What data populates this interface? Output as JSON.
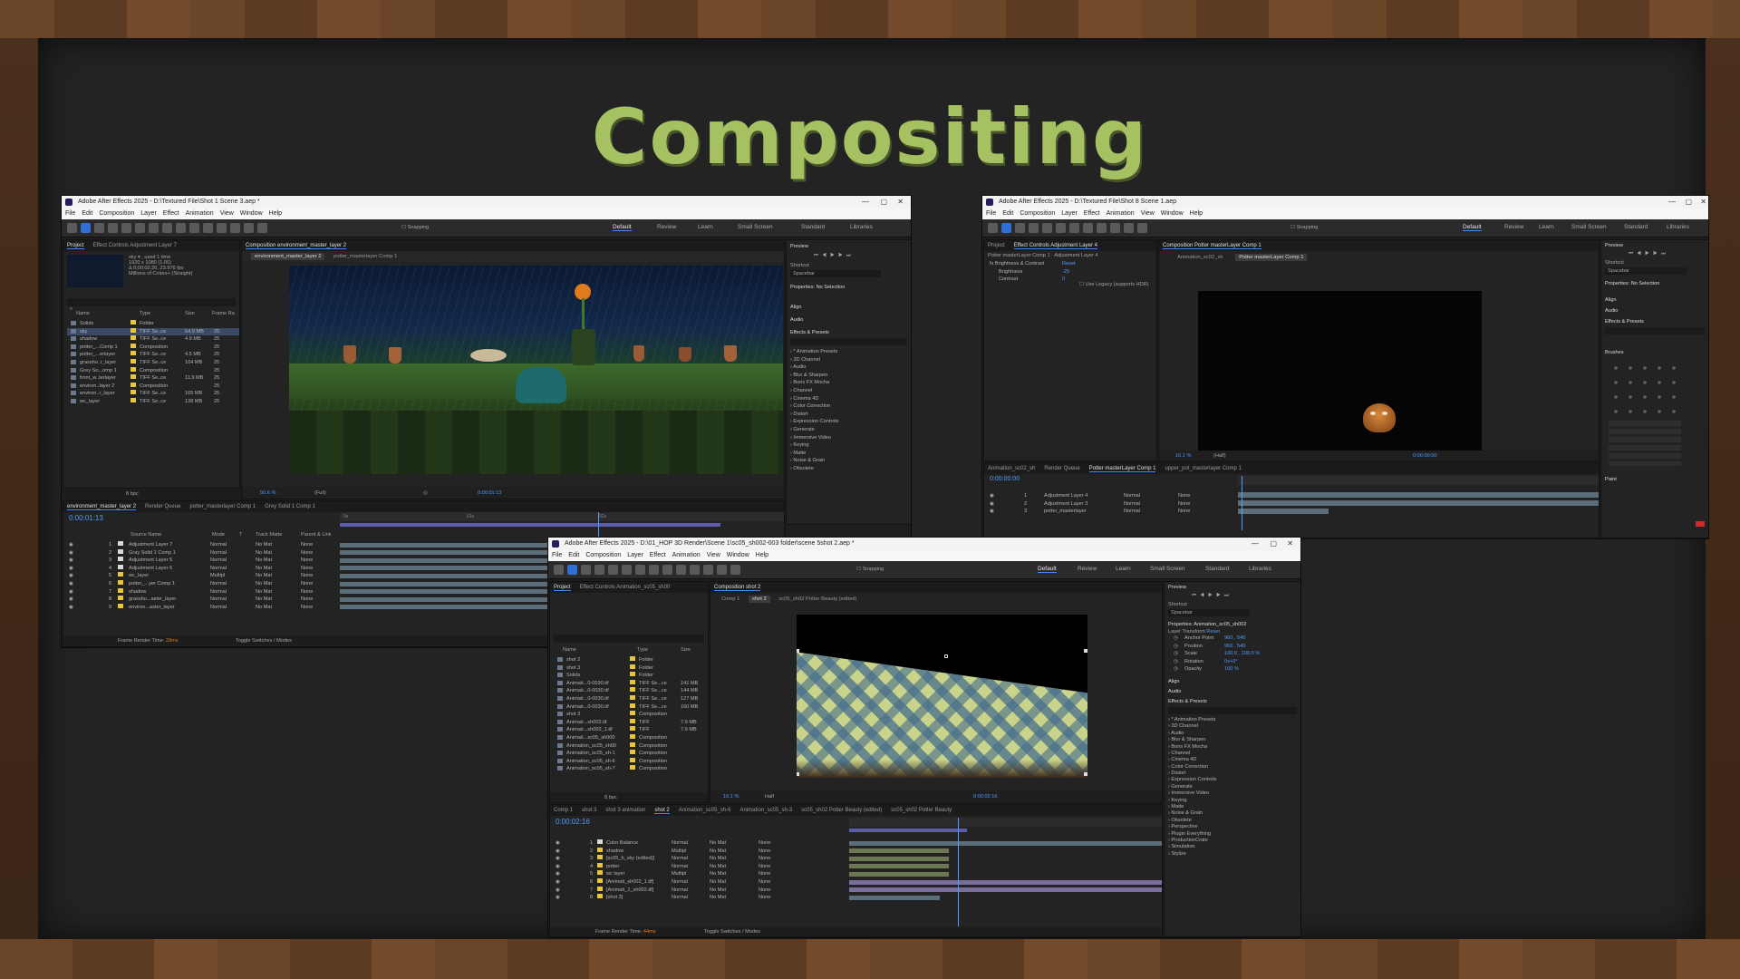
{
  "title": "Compositing",
  "win1": {
    "title": "Adobe After Effects 2025 - D:\\Textured File\\Shot 1 Scene 3.aep *",
    "menu": [
      "File",
      "Edit",
      "Composition",
      "Layer",
      "Effect",
      "Animation",
      "View",
      "Window",
      "Help"
    ],
    "snapping": "Snapping",
    "workspaces": [
      "Default",
      "Review",
      "Learn",
      "Small Screen",
      "Standard",
      "Libraries"
    ],
    "project_tab": "Project",
    "effect_controls_tab": "Effect Controls Adjustment Layer 7",
    "project_info": [
      "sky ▾ , used 1 time",
      "1920 x 1080 (1.00)",
      "Δ 0;00;02;26, 23.976 fps",
      "Millions of Colors+ (Straight)"
    ],
    "project_columns": [
      "Name",
      "Type",
      "Size",
      "Frame Ra"
    ],
    "project_items": [
      {
        "name": "Solids",
        "type": "Folder",
        "size": "",
        "fr": "",
        "color": "#e8c53a"
      },
      {
        "name": "sky",
        "type": "TIFF Se..ce",
        "size": "64.9 MB",
        "fr": "25",
        "color": "#e8c53a"
      },
      {
        "name": "shadow",
        "type": "TIFF Se..ce",
        "size": "4.9 MB",
        "fr": "25",
        "color": "#e8c53a"
      },
      {
        "name": "potter_...Comp 1",
        "type": "Composition",
        "size": "",
        "fr": "25",
        "color": "#e8c53a"
      },
      {
        "name": "potter_...erlayer",
        "type": "TIFF Se..ce",
        "size": "4.5 MB",
        "fr": "25",
        "color": "#e8c53a"
      },
      {
        "name": "grassho..r_layer",
        "type": "TIFF Se..ce",
        "size": "104 MB",
        "fr": "25",
        "color": "#e8c53a"
      },
      {
        "name": "Grey So...omp 1",
        "type": "Composition",
        "size": "",
        "fr": "25",
        "color": "#e8c53a"
      },
      {
        "name": "front_w..terlayer",
        "type": "TIFF Se..ce",
        "size": "11.9 MB",
        "fr": "25",
        "color": "#e8c53a"
      },
      {
        "name": "environ..layer 2",
        "type": "Composition",
        "size": "",
        "fr": "25",
        "color": "#e8c53a"
      },
      {
        "name": "environ..r_layer",
        "type": "TIFF Se..ce",
        "size": "165 MB",
        "fr": "25",
        "color": "#e8c53a"
      },
      {
        "name": "wc_layer",
        "type": "TIFF Se..ce",
        "size": "138 MB",
        "fr": "25",
        "color": "#e8c53a"
      }
    ],
    "bpc": "8 bpc",
    "comp_tab": "Composition environment_master_layer 2",
    "comp_subtabs": [
      "environment_master_layer 2",
      "potter_masterlayer Comp 1"
    ],
    "zoom": "50.6 %",
    "resolution": "(Full)",
    "timecode_viewer": "0:00:01:13",
    "preview_label": "Preview",
    "shortcut_label": "Shortcut",
    "shortcut_value": "Spacebar",
    "properties_label": "Properties: No Selection",
    "align_label": "Align",
    "audio_label": "Audio",
    "effects_label": "Effects & Presets",
    "effects_items": [
      "* Animation Presets",
      "3D Channel",
      "Audio",
      "Blur & Sharpen",
      "Boris FX Mocha",
      "Channel",
      "Cinema 4D",
      "Color Correction",
      "Distort",
      "Expression Controls",
      "Generate",
      "Immersive Video",
      "Keying",
      "Matte",
      "Noise & Grain",
      "Obsolete"
    ],
    "timeline_tabs": [
      "environment_master_layer 2",
      "Render Queue",
      "potter_masterlayer Comp 1",
      "Grey Solid 1 Comp 1"
    ],
    "timecode": "0:00:01:13",
    "layer_columns": [
      "Source Name",
      "Mode",
      "T",
      "Track Matte",
      "Parent & Link"
    ],
    "layers": [
      {
        "num": "1",
        "name": "Adjustment Layer 7",
        "mode": "Normal",
        "matte": "No Mat",
        "parent": "None",
        "color": "#d9d9d9"
      },
      {
        "num": "2",
        "name": "Gray Solid 1 Comp 1",
        "mode": "Normal",
        "matte": "No Mat",
        "parent": "None",
        "color": "#d9d9d9"
      },
      {
        "num": "3",
        "name": "Adjustment Layer 5",
        "mode": "Normal",
        "matte": "No Mat",
        "parent": "None",
        "color": "#d9d9d9"
      },
      {
        "num": "4",
        "name": "Adjustment Layer 6",
        "mode": "Normal",
        "matte": "No Mat",
        "parent": "None",
        "color": "#d9d9d9"
      },
      {
        "num": "5",
        "name": "wc_layer",
        "mode": "Multipl",
        "matte": "No Mat",
        "parent": "None",
        "color": "#e8c53a"
      },
      {
        "num": "6",
        "name": "potter_...yer Comp 1",
        "mode": "Normal",
        "matte": "No Mat",
        "parent": "None",
        "color": "#e8c53a"
      },
      {
        "num": "7",
        "name": "shadow",
        "mode": "Normal",
        "matte": "No Mat",
        "parent": "None",
        "color": "#e8c53a"
      },
      {
        "num": "8",
        "name": "grassho...aster_layer",
        "mode": "Normal",
        "matte": "No Mat",
        "parent": "None",
        "color": "#e8c53a"
      },
      {
        "num": "9",
        "name": "environ...aster_layer",
        "mode": "Normal",
        "matte": "No Mat",
        "parent": "None",
        "color": "#e8c53a"
      }
    ],
    "ruler_marks": [
      "0s",
      "01s",
      "02s"
    ],
    "frame_render": "Frame Render Time:",
    "frame_render_value": "29ms",
    "toggle_label": "Toggle Switches / Modes"
  },
  "win2": {
    "title": "Adobe After Effects 2025 - D:\\Textured File\\Shot 8 Scene 1.aep",
    "menu": [
      "File",
      "Edit",
      "Composition",
      "Layer",
      "Effect",
      "Animation",
      "View",
      "Window",
      "Help"
    ],
    "snapping": "Snapping",
    "workspaces": [
      "Default",
      "Review",
      "Learn",
      "Small Screen",
      "Standard",
      "Libraries"
    ],
    "project_tab": "Project",
    "effect_controls_tab": "Effect Controls Adjustment Layer 4",
    "ec_header": "Potter masterLayer Comp 1 · Adjustment Layer 4",
    "ec_items": [
      {
        "label": "fx  Brightness & Contrast",
        "value": "Reset"
      },
      {
        "label": "Brightness",
        "value": "-25"
      },
      {
        "label": "Contrast",
        "value": "0"
      }
    ],
    "legacy": "Use Legacy (supports HDR)",
    "comp_tab": "Composition Potter masterLayer Comp 1",
    "comp_subtabs": [
      "Animation_sc02_sh",
      "Potter masterLayer Comp 1"
    ],
    "zoom": "16.1 %",
    "resolution": "(Half)",
    "timecode_viewer": "0:00:00:00",
    "preview_label": "Preview",
    "shortcut_label": "Shortcut",
    "shortcut_value": "Spacebar",
    "properties_label": "Properties: No Selection",
    "align_label": "Align",
    "audio_label": "Audio",
    "effects_label": "Effects & Presets",
    "brushes_label": "Brushes",
    "paint_label": "Paint",
    "timeline_tabs": [
      "Animation_sc02_sh",
      "Render Queue",
      "Potter masterLayer Comp 1",
      "upper_pot_masterlayer Comp 1"
    ],
    "timecode": "0:00:00:00",
    "layers": [
      {
        "num": "1",
        "name": "Adjustment Layer 4",
        "mode": "Normal",
        "parent": "None"
      },
      {
        "num": "2",
        "name": "Adjustment Layer 3",
        "mode": "Normal",
        "parent": "None"
      },
      {
        "num": "3",
        "name": "potter_masterlayer",
        "mode": "Normal",
        "parent": "None"
      }
    ]
  },
  "win3": {
    "title": "Adobe After Effects 2025 - D:\\01_HOP 3D Render\\Scene 1\\sc05_sh002-003 folder\\scene 5shot 2.aep *",
    "menu": [
      "File",
      "Edit",
      "Composition",
      "Layer",
      "Effect",
      "Animation",
      "View",
      "Window",
      "Help"
    ],
    "snapping": "Snapping",
    "workspaces": [
      "Default",
      "Review",
      "Learn",
      "Small Screen",
      "Standard",
      "Libraries"
    ],
    "project_tab": "Project",
    "effect_controls_tab": "Effect Controls Animation_sc05_sh00",
    "project_columns": [
      "Name",
      "Type",
      "Size"
    ],
    "project_items": [
      {
        "name": "shot 2",
        "type": "Folder",
        "size": ""
      },
      {
        "name": "shot 3",
        "type": "Folder",
        "size": ""
      },
      {
        "name": "Solids",
        "type": "Folder",
        "size": ""
      },
      {
        "name": "Animati...0-0030.tif",
        "type": "TIFF Se...ce",
        "size": "141 MB"
      },
      {
        "name": "Animati...0-0030.tif",
        "type": "TIFF Se...ce",
        "size": "144 MB"
      },
      {
        "name": "Animati...0-0030.tif",
        "type": "TIFF Se...ce",
        "size": "127 MB"
      },
      {
        "name": "Animati...0-0030.tif",
        "type": "TIFF Se...ce",
        "size": "160 MB"
      },
      {
        "name": "shot 3",
        "type": "Composition",
        "size": ""
      },
      {
        "name": "Animati...sh002.tif",
        "type": "TIFF",
        "size": "7.9 MB"
      },
      {
        "name": "Animati...sh002_1.tif",
        "type": "TIFF",
        "size": "7.9 MB"
      },
      {
        "name": "Animati...sc05_sh000",
        "type": "Composition",
        "size": ""
      },
      {
        "name": "Animation_sc05_sh00",
        "type": "Composition",
        "size": ""
      },
      {
        "name": "Animation_sc05_sh-1",
        "type": "Composition",
        "size": ""
      },
      {
        "name": "Animation_sc05_sh-6",
        "type": "Composition",
        "size": ""
      },
      {
        "name": "Animation_sc05_sh-7",
        "type": "Composition",
        "size": ""
      }
    ],
    "bpc": "8 bpc",
    "comp_tab": "Composition shot 2",
    "comp_subtabs": [
      "Comp 1",
      "shot 2",
      "sc05_sh02 Potter Beauty (edited)"
    ],
    "zoom": "16.1 %",
    "resolution": "Half",
    "timecode_viewer": "0:00:02:16",
    "preview_label": "Preview",
    "shortcut_label": "Shortcut",
    "shortcut_value": "Spacebar",
    "properties_label": "Properties: Animation_sc05_sh002",
    "layer_transform": "Layer Transform",
    "reset": "Reset",
    "props": [
      {
        "label": "Anchor Point",
        "value": "960 , 540"
      },
      {
        "label": "Position",
        "value": "960 , 540"
      },
      {
        "label": "Scale",
        "value": "100.0 , 100.0 %"
      },
      {
        "label": "Rotation",
        "value": "0x+0°"
      },
      {
        "label": "Opacity",
        "value": "100 %"
      }
    ],
    "align_label": "Align",
    "audio_label": "Audio",
    "effects_label": "Effects & Presets",
    "effects_items": [
      "* Animation Presets",
      "3D Channel",
      "Audio",
      "Blur & Sharpen",
      "Boris FX Mocha",
      "Channel",
      "Cinema 4D",
      "Color Correction",
      "Distort",
      "Expression Controls",
      "Generate",
      "Immersive Video",
      "Keying",
      "Matte",
      "Noise & Grain",
      "Obsolete",
      "Perspective",
      "Plugin Everything",
      "ProductionCrate",
      "Simulation",
      "Stylize"
    ],
    "timeline_tabs": [
      "Comp 1",
      "shot 3",
      "shot 3 animation",
      "shot 2",
      "Animation_sc05_sh-6",
      "Animation_sc05_sh-3",
      "sc05_sh02 Potter Beauty (edited)",
      "sc05_sh02 Potter Beauty"
    ],
    "timecode": "0:00:02:16",
    "layers": [
      {
        "num": "1",
        "name": "Color Balance",
        "mode": "Normal",
        "matte": "No Mat",
        "parent": "None",
        "color": "#d9d9d9"
      },
      {
        "num": "2",
        "name": "shadow",
        "mode": "Multipl",
        "matte": "No Mat",
        "parent": "None",
        "color": "#e8c53a"
      },
      {
        "num": "3",
        "name": "[sc05_h_sky (edited)]",
        "mode": "Normal",
        "matte": "No Mat",
        "parent": "None",
        "color": "#e8c53a"
      },
      {
        "num": "4",
        "name": "potter",
        "mode": "Normal",
        "matte": "No Mat",
        "parent": "None",
        "color": "#e8c53a"
      },
      {
        "num": "5",
        "name": "wc layer",
        "mode": "Multipl",
        "matte": "No Mat",
        "parent": "None",
        "color": "#e8c53a"
      },
      {
        "num": "6",
        "name": "[Animati_sh002_1.tif]",
        "mode": "Normal",
        "matte": "No Mat",
        "parent": "None",
        "color": "#e8c53a"
      },
      {
        "num": "7",
        "name": "[Animati_1_sh002.tif]",
        "mode": "Normal",
        "matte": "No Mat",
        "parent": "None",
        "color": "#e8c53a"
      },
      {
        "num": "8",
        "name": "[shot 3]",
        "mode": "Normal",
        "matte": "No Mat",
        "parent": "None",
        "color": "#e8c53a"
      }
    ],
    "frame_render": "Frame Render Time:",
    "frame_render_value": "44ms",
    "toggle_label": "Toggle Switches / Modes"
  }
}
